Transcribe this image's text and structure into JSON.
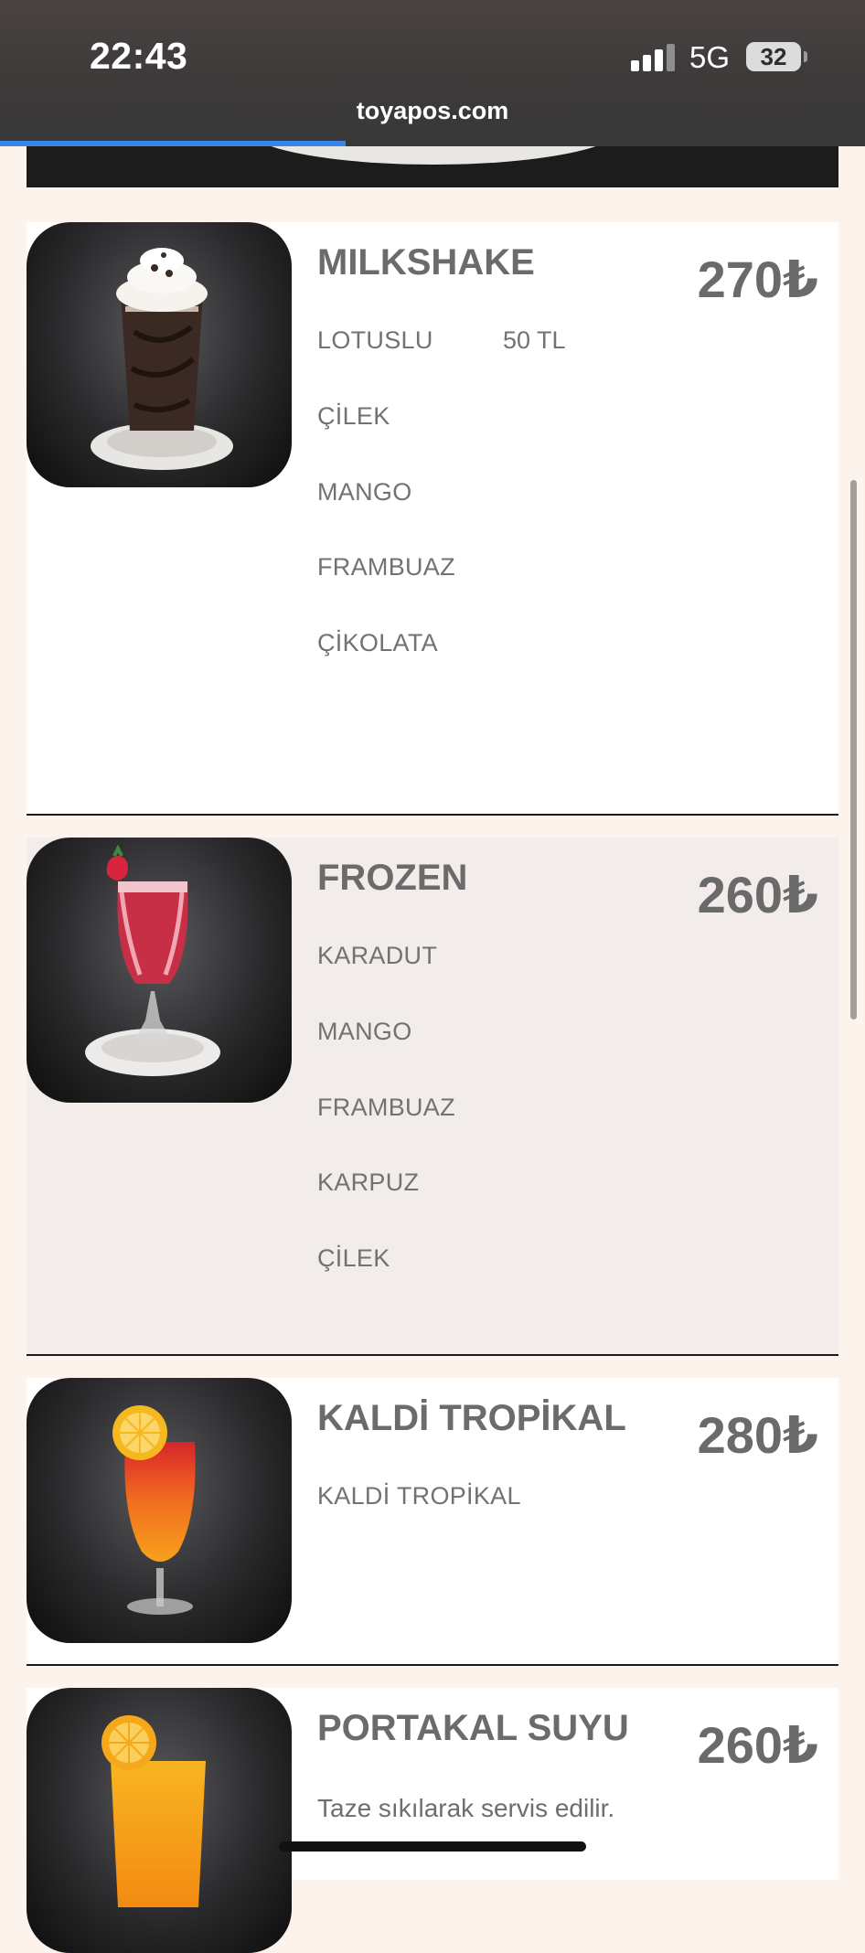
{
  "status_bar": {
    "time": "22:43",
    "network": "5G",
    "battery": "32",
    "url": "toyapos.com",
    "load_progress": 0.4
  },
  "products": [
    {
      "title": "MILKSHAKE",
      "price": "270₺",
      "options": [
        {
          "name": "LOTUSLU",
          "extra": "50 TL"
        },
        {
          "name": "ÇİLEK"
        },
        {
          "name": "MANGO"
        },
        {
          "name": "FRAMBUAZ"
        },
        {
          "name": "ÇİKOLATA"
        }
      ],
      "image_icon": "milkshake-image"
    },
    {
      "title": "FROZEN",
      "price": "260₺",
      "options": [
        {
          "name": "KARADUT"
        },
        {
          "name": "MANGO"
        },
        {
          "name": "FRAMBUAZ"
        },
        {
          "name": "KARPUZ"
        },
        {
          "name": "ÇİLEK"
        }
      ],
      "image_icon": "frozen-drink-image"
    },
    {
      "title": "KALDİ TROPİKAL",
      "price": "280₺",
      "options": [
        {
          "name": "KALDİ TROPİKAL"
        }
      ],
      "image_icon": "tropical-cocktail-image"
    },
    {
      "title": "PORTAKAL SUYU",
      "price": "260₺",
      "description": "Taze sıkılarak servis edilir.",
      "image_icon": "orange-juice-image"
    }
  ],
  "colors": {
    "page_background": "#fcf4ec",
    "card_white": "#ffffff",
    "card_grey": "#f2eceb",
    "text": "#6a6a6a",
    "progress": "#3a86e8"
  }
}
